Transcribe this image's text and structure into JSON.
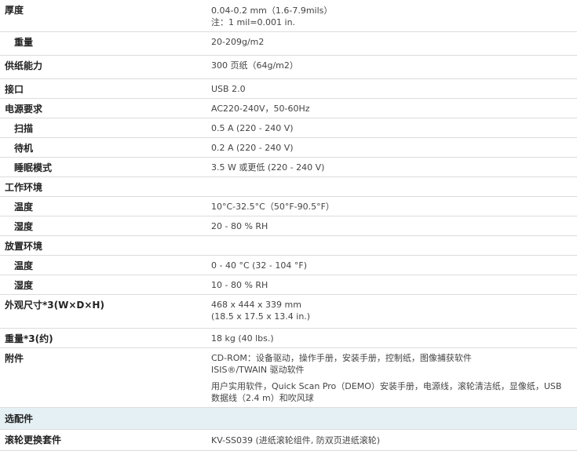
{
  "specs": {
    "thickness": {
      "label": "厚度",
      "v1": "0.04-0.2 mm（1.6-7.9mils）",
      "v2": "注：1 mil=0.001 in."
    },
    "weight_paper": {
      "label": "重量",
      "v1": "20-209g/m2"
    },
    "feeder": {
      "label": "供纸能力",
      "v1": "300 页纸（64g/m2）"
    },
    "interface": {
      "label": "接口",
      "v1": "USB 2.0"
    },
    "power": {
      "label": "电源要求",
      "v1": "AC220-240V，50-60Hz"
    },
    "scan": {
      "label": "扫描",
      "v1": "0.5 A (220 - 240 V)"
    },
    "standby": {
      "label": "待机",
      "v1": "0.2 A (220 - 240 V)"
    },
    "sleep": {
      "label": "睡眠模式",
      "v1": "3.5 W 或更低 (220 - 240 V)"
    },
    "op_env": {
      "label": "工作环境"
    },
    "op_temp": {
      "label": "温度",
      "v1": "10°C-32.5°C（50°F-90.5°F）"
    },
    "op_hum": {
      "label": "湿度",
      "v1": "20 - 80 % RH"
    },
    "st_env": {
      "label": "放置环境"
    },
    "st_temp": {
      "label": "温度",
      "v1": "0 - 40 °C (32 - 104 °F)"
    },
    "st_hum": {
      "label": "湿度",
      "v1": "10 - 80 % RH"
    },
    "dims": {
      "label": "外观尺寸*3(W×D×H)",
      "v1": "468 x 444 x 339 mm",
      "v2": "(18.5 x 17.5 x 13.4 in.)"
    },
    "mass": {
      "label": "重量*3(约)",
      "v1": "18 kg (40 lbs.)"
    },
    "accessories": {
      "label": "附件",
      "v1": "CD-ROM：设备驱动，操作手册，安装手册，控制纸，图像捕获软件",
      "v2": "ISIS®/TWAIN 驱动软件",
      "v3": "用户实用软件，Quick Scan Pro（DEMO）安装手册，电源线，滚轮清洁纸，显像纸，USB",
      "v4": "数据线（2.4 m）和吹风球"
    }
  },
  "options_section": {
    "label": "选配件"
  },
  "roller_kit": {
    "label": "滚轮更换套件",
    "v1": "KV-SS039 (进纸滚轮组件, 防双页进纸滚轮)"
  }
}
